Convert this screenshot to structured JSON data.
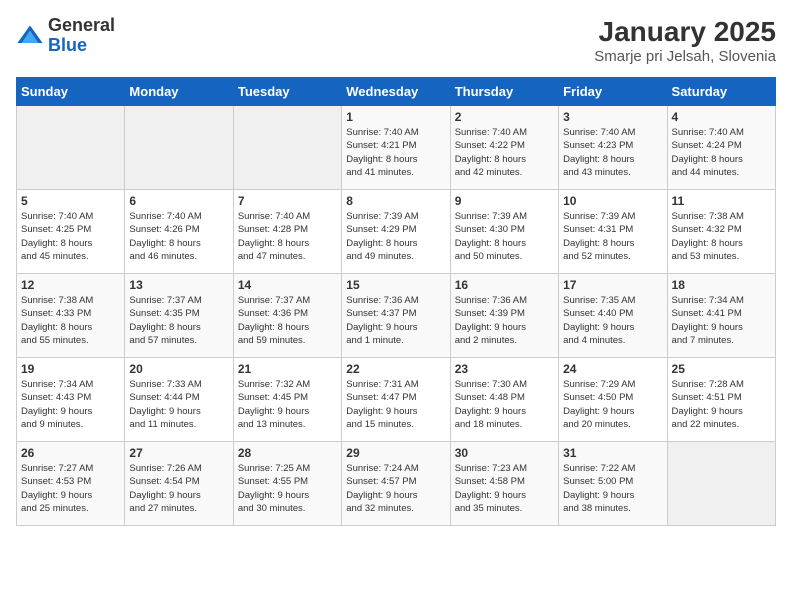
{
  "header": {
    "logo_general": "General",
    "logo_blue": "Blue",
    "title": "January 2025",
    "subtitle": "Smarje pri Jelsah, Slovenia"
  },
  "weekdays": [
    "Sunday",
    "Monday",
    "Tuesday",
    "Wednesday",
    "Thursday",
    "Friday",
    "Saturday"
  ],
  "weeks": [
    [
      {
        "day": "",
        "info": ""
      },
      {
        "day": "",
        "info": ""
      },
      {
        "day": "",
        "info": ""
      },
      {
        "day": "1",
        "info": "Sunrise: 7:40 AM\nSunset: 4:21 PM\nDaylight: 8 hours\nand 41 minutes."
      },
      {
        "day": "2",
        "info": "Sunrise: 7:40 AM\nSunset: 4:22 PM\nDaylight: 8 hours\nand 42 minutes."
      },
      {
        "day": "3",
        "info": "Sunrise: 7:40 AM\nSunset: 4:23 PM\nDaylight: 8 hours\nand 43 minutes."
      },
      {
        "day": "4",
        "info": "Sunrise: 7:40 AM\nSunset: 4:24 PM\nDaylight: 8 hours\nand 44 minutes."
      }
    ],
    [
      {
        "day": "5",
        "info": "Sunrise: 7:40 AM\nSunset: 4:25 PM\nDaylight: 8 hours\nand 45 minutes."
      },
      {
        "day": "6",
        "info": "Sunrise: 7:40 AM\nSunset: 4:26 PM\nDaylight: 8 hours\nand 46 minutes."
      },
      {
        "day": "7",
        "info": "Sunrise: 7:40 AM\nSunset: 4:28 PM\nDaylight: 8 hours\nand 47 minutes."
      },
      {
        "day": "8",
        "info": "Sunrise: 7:39 AM\nSunset: 4:29 PM\nDaylight: 8 hours\nand 49 minutes."
      },
      {
        "day": "9",
        "info": "Sunrise: 7:39 AM\nSunset: 4:30 PM\nDaylight: 8 hours\nand 50 minutes."
      },
      {
        "day": "10",
        "info": "Sunrise: 7:39 AM\nSunset: 4:31 PM\nDaylight: 8 hours\nand 52 minutes."
      },
      {
        "day": "11",
        "info": "Sunrise: 7:38 AM\nSunset: 4:32 PM\nDaylight: 8 hours\nand 53 minutes."
      }
    ],
    [
      {
        "day": "12",
        "info": "Sunrise: 7:38 AM\nSunset: 4:33 PM\nDaylight: 8 hours\nand 55 minutes."
      },
      {
        "day": "13",
        "info": "Sunrise: 7:37 AM\nSunset: 4:35 PM\nDaylight: 8 hours\nand 57 minutes."
      },
      {
        "day": "14",
        "info": "Sunrise: 7:37 AM\nSunset: 4:36 PM\nDaylight: 8 hours\nand 59 minutes."
      },
      {
        "day": "15",
        "info": "Sunrise: 7:36 AM\nSunset: 4:37 PM\nDaylight: 9 hours\nand 1 minute."
      },
      {
        "day": "16",
        "info": "Sunrise: 7:36 AM\nSunset: 4:39 PM\nDaylight: 9 hours\nand 2 minutes."
      },
      {
        "day": "17",
        "info": "Sunrise: 7:35 AM\nSunset: 4:40 PM\nDaylight: 9 hours\nand 4 minutes."
      },
      {
        "day": "18",
        "info": "Sunrise: 7:34 AM\nSunset: 4:41 PM\nDaylight: 9 hours\nand 7 minutes."
      }
    ],
    [
      {
        "day": "19",
        "info": "Sunrise: 7:34 AM\nSunset: 4:43 PM\nDaylight: 9 hours\nand 9 minutes."
      },
      {
        "day": "20",
        "info": "Sunrise: 7:33 AM\nSunset: 4:44 PM\nDaylight: 9 hours\nand 11 minutes."
      },
      {
        "day": "21",
        "info": "Sunrise: 7:32 AM\nSunset: 4:45 PM\nDaylight: 9 hours\nand 13 minutes."
      },
      {
        "day": "22",
        "info": "Sunrise: 7:31 AM\nSunset: 4:47 PM\nDaylight: 9 hours\nand 15 minutes."
      },
      {
        "day": "23",
        "info": "Sunrise: 7:30 AM\nSunset: 4:48 PM\nDaylight: 9 hours\nand 18 minutes."
      },
      {
        "day": "24",
        "info": "Sunrise: 7:29 AM\nSunset: 4:50 PM\nDaylight: 9 hours\nand 20 minutes."
      },
      {
        "day": "25",
        "info": "Sunrise: 7:28 AM\nSunset: 4:51 PM\nDaylight: 9 hours\nand 22 minutes."
      }
    ],
    [
      {
        "day": "26",
        "info": "Sunrise: 7:27 AM\nSunset: 4:53 PM\nDaylight: 9 hours\nand 25 minutes."
      },
      {
        "day": "27",
        "info": "Sunrise: 7:26 AM\nSunset: 4:54 PM\nDaylight: 9 hours\nand 27 minutes."
      },
      {
        "day": "28",
        "info": "Sunrise: 7:25 AM\nSunset: 4:55 PM\nDaylight: 9 hours\nand 30 minutes."
      },
      {
        "day": "29",
        "info": "Sunrise: 7:24 AM\nSunset: 4:57 PM\nDaylight: 9 hours\nand 32 minutes."
      },
      {
        "day": "30",
        "info": "Sunrise: 7:23 AM\nSunset: 4:58 PM\nDaylight: 9 hours\nand 35 minutes."
      },
      {
        "day": "31",
        "info": "Sunrise: 7:22 AM\nSunset: 5:00 PM\nDaylight: 9 hours\nand 38 minutes."
      },
      {
        "day": "",
        "info": ""
      }
    ]
  ]
}
